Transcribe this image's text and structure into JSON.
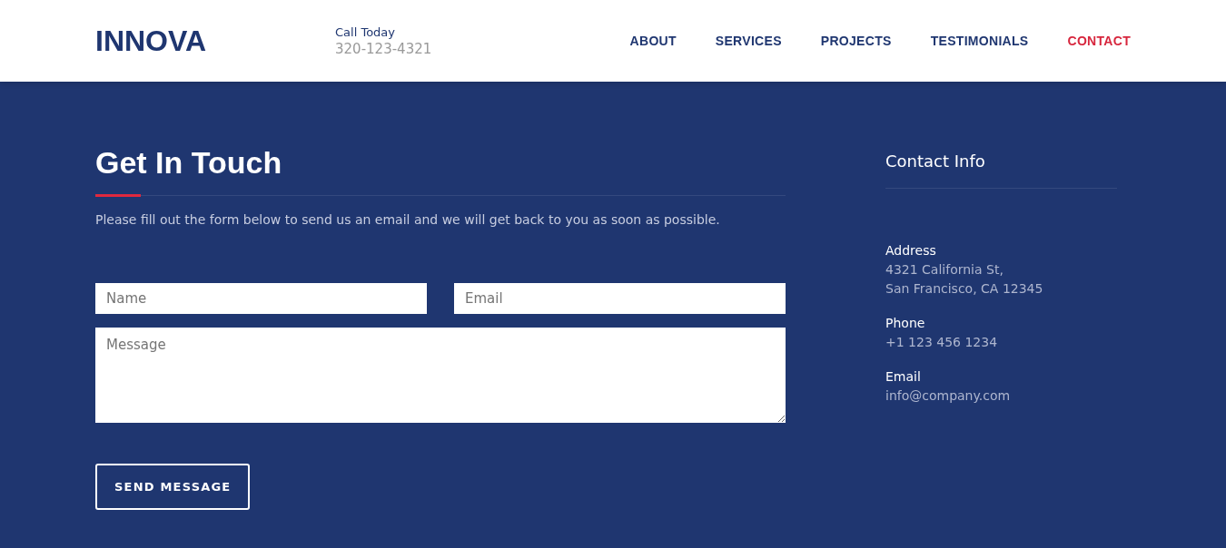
{
  "header": {
    "logo": "INNOVA",
    "call_label": "Call Today",
    "call_number": "320-123-4321",
    "nav": [
      {
        "label": "ABOUT",
        "selected": false
      },
      {
        "label": "SERVICES",
        "selected": false
      },
      {
        "label": "PROJECTS",
        "selected": false
      },
      {
        "label": "TESTIMONIALS",
        "selected": false
      },
      {
        "label": "CONTACT",
        "selected": true
      }
    ]
  },
  "form": {
    "title": "Get In Touch",
    "intro": "Please fill out the form below to send us an email and we will get back to you as soon as possible.",
    "name_field": {
      "placeholder": "Name"
    },
    "email_field": {
      "placeholder": "Email"
    },
    "message_field": {
      "placeholder": "Message"
    },
    "submit": "SEND MESSAGE"
  },
  "contact_info": {
    "title": "Contact Info",
    "items": [
      {
        "label": "Address",
        "lines": [
          "4321 California St,",
          "San Francisco, CA 12345"
        ]
      },
      {
        "label": "Phone",
        "lines": [
          "+1 123 456 1234"
        ]
      },
      {
        "label": "Email",
        "lines": [
          "info@company.com"
        ]
      }
    ]
  }
}
